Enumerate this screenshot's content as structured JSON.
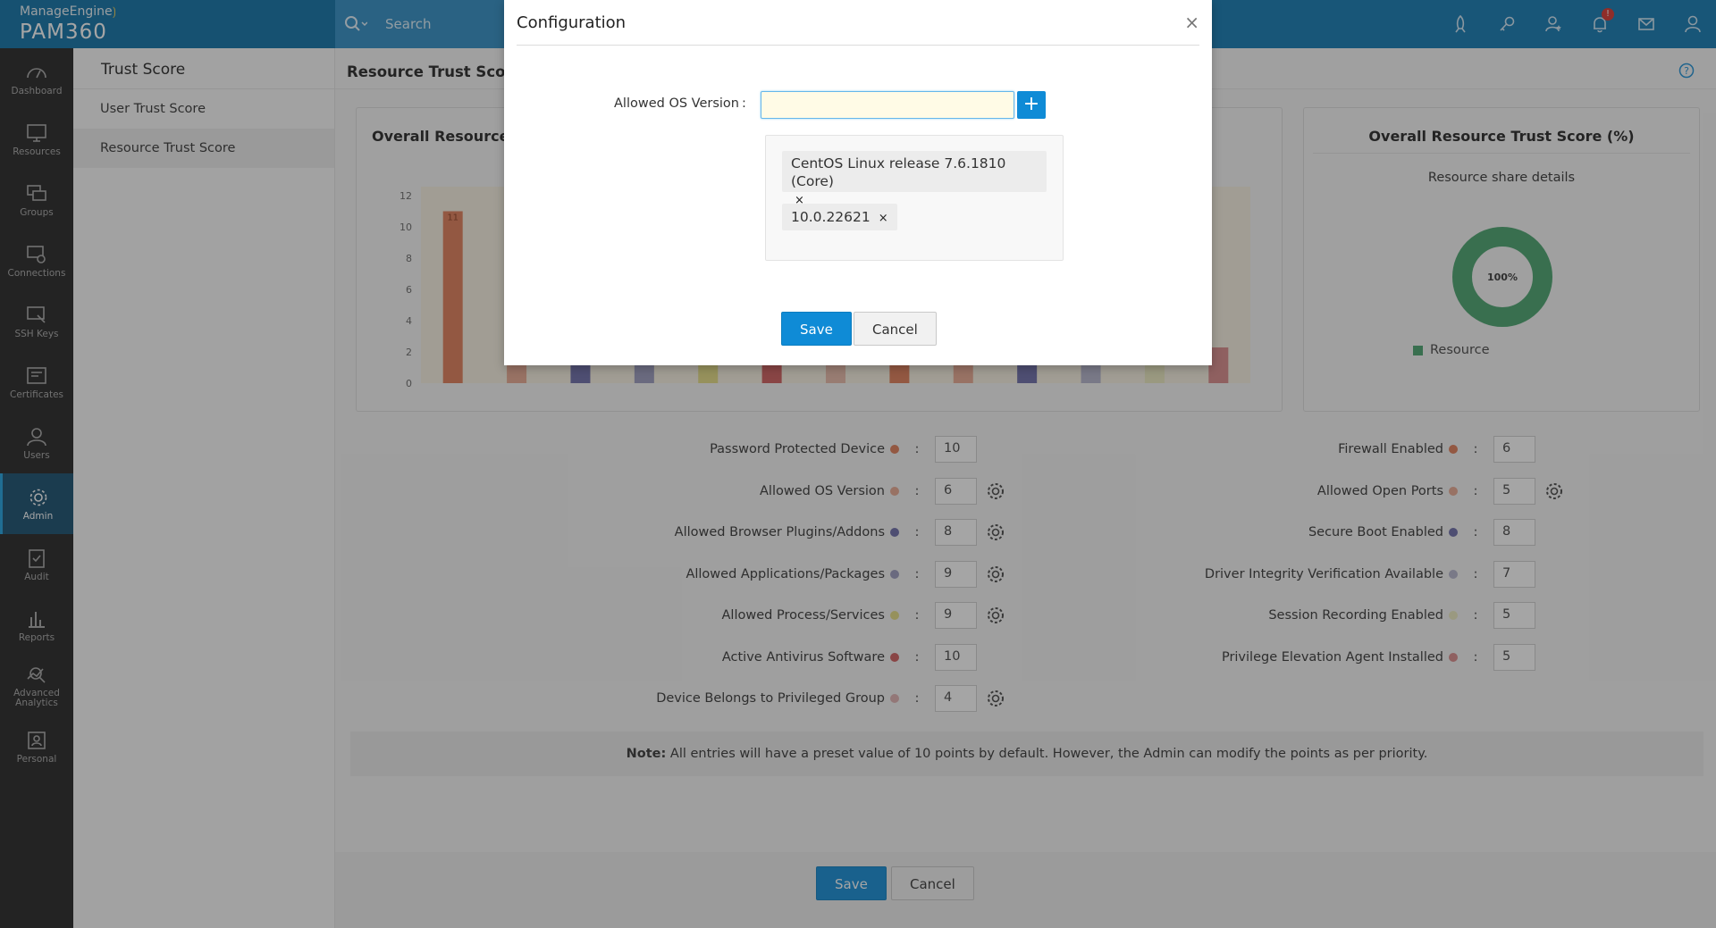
{
  "app": {
    "vendor": "ManageEngine",
    "product": "PAM360"
  },
  "header": {
    "search_placeholder": "Search",
    "notification_count": "!"
  },
  "leftnav": {
    "items": [
      {
        "label": "Dashboard"
      },
      {
        "label": "Resources"
      },
      {
        "label": "Groups"
      },
      {
        "label": "Connections"
      },
      {
        "label": "SSH Keys"
      },
      {
        "label": "Certificates"
      },
      {
        "label": "Users"
      },
      {
        "label": "Admin"
      },
      {
        "label": "Audit"
      },
      {
        "label": "Reports"
      },
      {
        "label": "Advanced Analytics"
      },
      {
        "label": "Personal"
      }
    ],
    "active": "Admin"
  },
  "subsidebar": {
    "title": "Trust Score",
    "items": [
      {
        "label": "User Trust Score"
      },
      {
        "label": "Resource Trust Score"
      }
    ]
  },
  "main": {
    "title": "Resource Trust Score",
    "chart_panel_title": "Overall Resource T",
    "pie_panel_title": "Overall Resource Trust Score (%)",
    "pie_subtitle": "Resource share details",
    "pie_legend": "Resource",
    "left_rows": [
      {
        "label": "Password Protected Device",
        "value": "10",
        "color": "#e07b55",
        "gear": false
      },
      {
        "label": "Allowed OS Version",
        "value": "6",
        "color": "#e8a890",
        "gear": true
      },
      {
        "label": "Allowed Browser Plugins/Addons",
        "value": "8",
        "color": "#6a6aa8",
        "gear": true
      },
      {
        "label": "Allowed Applications/Packages",
        "value": "9",
        "color": "#9a9abd",
        "gear": true
      },
      {
        "label": "Allowed Process/Services",
        "value": "9",
        "color": "#e6dc82",
        "gear": true
      },
      {
        "label": "Active Antivirus Software",
        "value": "10",
        "color": "#cf5a5a",
        "gear": false
      },
      {
        "label": "Device Belongs to Privileged Group",
        "value": "4",
        "color": "#e0b0b0",
        "gear": true
      }
    ],
    "right_rows": [
      {
        "label": "Firewall Enabled",
        "value": "6",
        "color": "#e07b55",
        "gear": false
      },
      {
        "label": "Allowed Open Ports",
        "value": "5",
        "color": "#e8a890",
        "gear": true
      },
      {
        "label": "Secure Boot Enabled",
        "value": "8",
        "color": "#6a6aa8",
        "gear": false
      },
      {
        "label": "Driver Integrity Verification Available",
        "value": "7",
        "color": "#b3b3cc",
        "gear": false
      },
      {
        "label": "Session Recording Enabled",
        "value": "5",
        "color": "#ecebc0",
        "gear": false
      },
      {
        "label": "Privilege Elevation Agent Installed",
        "value": "5",
        "color": "#d98888",
        "gear": false
      }
    ],
    "note_label": "Note:",
    "note_text": " All entries will have a preset value of 10 points by default. However, the Admin can modify the points as per priority.",
    "save_label": "Save",
    "cancel_label": "Cancel"
  },
  "chart_data": [
    {
      "type": "bar",
      "title": "Overall Resource T",
      "ylim": [
        0,
        12
      ],
      "yticks": [
        "12",
        "10",
        "8",
        "6",
        "4",
        "2",
        "0"
      ],
      "visible_value_label": "11",
      "values": [
        11,
        null,
        null,
        null,
        null,
        null,
        null,
        null,
        null,
        null,
        null,
        null,
        null
      ],
      "colors": [
        "#e07b55",
        "#e8a890",
        "#6a6aa8",
        "#9a9abd",
        "#e6dc82",
        "#cf5a5a",
        "#e8b8a8",
        "#e07b55",
        "#e8a890",
        "#6a6aa8",
        "#b3b3cc",
        "#ecebc0",
        "#d98888"
      ]
    },
    {
      "type": "pie",
      "title": "Overall Resource Trust Score (%)",
      "slices": [
        {
          "name": "Resource",
          "value": 100,
          "label": "100%",
          "color": "#46a36c"
        }
      ]
    }
  ],
  "modal": {
    "title": "Configuration",
    "close": "×",
    "field_label": "Allowed OS Version",
    "colon": ":",
    "input_value": "",
    "plus": "+",
    "tags": [
      {
        "text": "CentOS Linux release 7.6.1810 (Core)",
        "remove": "×"
      },
      {
        "text": "10.0.22621",
        "remove": "×"
      }
    ],
    "save_label": "Save",
    "cancel_label": "Cancel"
  }
}
